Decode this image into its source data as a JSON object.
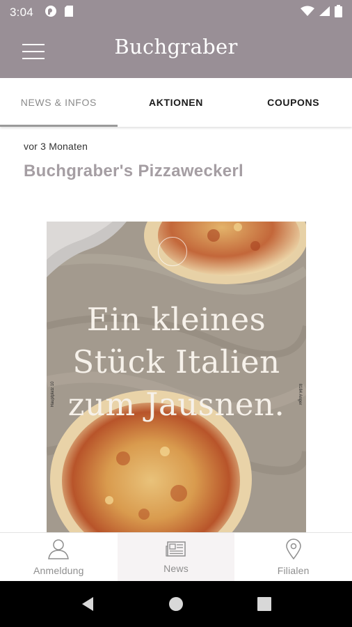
{
  "status_bar": {
    "time": "3:04",
    "left_icons": [
      "podcast-icon",
      "sd-card-icon"
    ],
    "right_icons": [
      "wifi-icon",
      "signal-icon",
      "battery-icon"
    ]
  },
  "app_bar": {
    "brand": "Buchgraber",
    "menu_icon": "hamburger-menu-icon"
  },
  "tabs": [
    {
      "label": "NEWS & INFOS",
      "active": true
    },
    {
      "label": "AKTIONEN",
      "active": false
    },
    {
      "label": "COUPONS",
      "active": false
    }
  ],
  "post": {
    "date": "vor 3 Monaten",
    "title": "Buchgraber's Pizzaweckerl",
    "image": {
      "headline_lines": [
        "Ein kleines",
        "Stück Italien",
        "zum Jausnen."
      ],
      "side_left": "Hauptplatz 10",
      "side_right": "8184 Anger"
    }
  },
  "bottom_nav": [
    {
      "label": "Anmeldung",
      "icon": "user-icon",
      "active": false
    },
    {
      "label": "News",
      "icon": "newspaper-icon",
      "active": true
    },
    {
      "label": "Filialen",
      "icon": "location-pin-icon",
      "active": false
    }
  ],
  "system_nav": [
    "back-icon",
    "home-icon",
    "recents-icon"
  ],
  "colors": {
    "app_bar": "#998f96",
    "title": "#a59ea3",
    "system_nav": "#000000"
  }
}
